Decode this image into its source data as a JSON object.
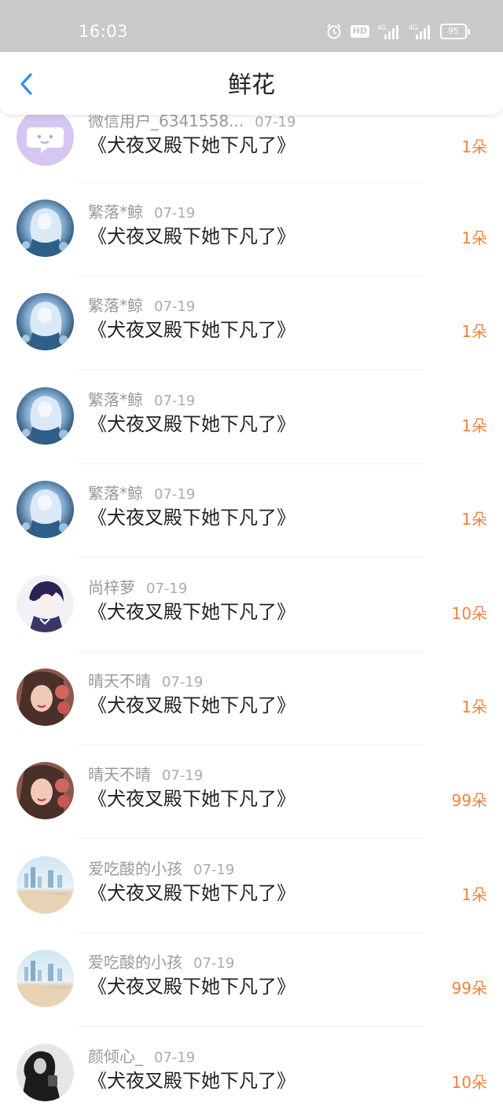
{
  "status_bar": {
    "time": "16:03",
    "hd_label": "HD",
    "battery": "95",
    "icons": [
      "alarm-icon",
      "hd-voice-icon",
      "4g-signal-icon",
      "4g-signal-icon",
      "battery-icon"
    ]
  },
  "header": {
    "title": "鲜花",
    "back_icon": "chevron-left-icon"
  },
  "colors": {
    "accent": "#2f8ff0",
    "count": "#f5833b",
    "status_bar": "#c9c9c9"
  },
  "items": [
    {
      "user": "微信用户_6341558...",
      "date": "07-19",
      "book": "《犬夜叉殿下她下凡了》",
      "count": "1朵",
      "avatar": "wechat-default-avatar"
    },
    {
      "user": "繁落*鲸",
      "date": "07-19",
      "book": "《犬夜叉殿下她下凡了》",
      "count": "1朵",
      "avatar": "anime-girl-blue-avatar"
    },
    {
      "user": "繁落*鲸",
      "date": "07-19",
      "book": "《犬夜叉殿下她下凡了》",
      "count": "1朵",
      "avatar": "anime-girl-blue-avatar"
    },
    {
      "user": "繁落*鲸",
      "date": "07-19",
      "book": "《犬夜叉殿下她下凡了》",
      "count": "1朵",
      "avatar": "anime-girl-blue-avatar"
    },
    {
      "user": "繁落*鲸",
      "date": "07-19",
      "book": "《犬夜叉殿下她下凡了》",
      "count": "1朵",
      "avatar": "anime-girl-blue-avatar"
    },
    {
      "user": "尚梓萝",
      "date": "07-19",
      "book": "《犬夜叉殿下她下凡了》",
      "count": "10朵",
      "avatar": "anime-boy-purple-avatar"
    },
    {
      "user": "晴天不晴",
      "date": "07-19",
      "book": "《犬夜叉殿下她下凡了》",
      "count": "1朵",
      "avatar": "girl-with-roses-avatar"
    },
    {
      "user": "晴天不晴",
      "date": "07-19",
      "book": "《犬夜叉殿下她下凡了》",
      "count": "99朵",
      "avatar": "girl-with-roses-avatar"
    },
    {
      "user": "爱吃酸的小孩",
      "date": "07-19",
      "book": "《犬夜叉殿下她下凡了》",
      "count": "1朵",
      "avatar": "city-skyline-avatar"
    },
    {
      "user": "爱吃酸的小孩",
      "date": "07-19",
      "book": "《犬夜叉殿下她下凡了》",
      "count": "99朵",
      "avatar": "city-skyline-avatar"
    },
    {
      "user": "颜倾心_",
      "date": "07-19",
      "book": "《犬夜叉殿下她下凡了》",
      "count": "10朵",
      "avatar": "monochrome-person-avatar"
    }
  ]
}
